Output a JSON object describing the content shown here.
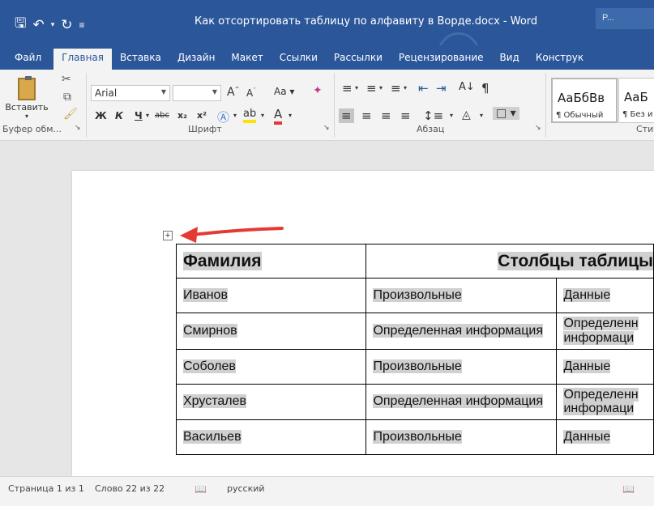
{
  "window": {
    "title": "Как отсортировать таблицу по алфавиту в Ворде.docx  -  Word",
    "account": "P..."
  },
  "qat": {
    "save_icon": "save-icon",
    "undo_icon": "undo-icon",
    "redo_icon": "redo-icon"
  },
  "tabs": [
    {
      "label": "Файл"
    },
    {
      "label": "Главная"
    },
    {
      "label": "Вставка"
    },
    {
      "label": "Дизайн"
    },
    {
      "label": "Макет"
    },
    {
      "label": "Ссылки"
    },
    {
      "label": "Рассылки"
    },
    {
      "label": "Рецензирование"
    },
    {
      "label": "Вид"
    },
    {
      "label": "Конструк"
    }
  ],
  "ribbon": {
    "clipboard": {
      "paste_label": "Вставить",
      "group_label": "Буфер обм..."
    },
    "font": {
      "font_name": "Arial",
      "font_size": "",
      "group_label": "Шрифт",
      "bold": "Ж",
      "italic": "К",
      "underline": "Ч",
      "strike": "abc",
      "subscript": "x₂",
      "superscript": "x²",
      "case": "Aa",
      "grow": "A",
      "shrink": "A"
    },
    "paragraph": {
      "group_label": "Абзац",
      "pilcrow": "¶"
    },
    "styles": {
      "group_label": "Сти",
      "items": [
        {
          "sample": "АаБбВв",
          "name": "¶ Обычный"
        },
        {
          "sample": "АаБ",
          "name": "¶ Без и"
        }
      ]
    }
  },
  "table": {
    "header": {
      "col1": "Фамилия",
      "col2": "Столбцы таблицы"
    },
    "rows": [
      {
        "name": "Иванов",
        "c2": "Произвольные",
        "c3": "Данные"
      },
      {
        "name": "Смирнов",
        "c2": "Определенная информация",
        "c3": "Определенн информаци"
      },
      {
        "name": "Соболев",
        "c2": "Произвольные",
        "c3": "Данные"
      },
      {
        "name": "Хрусталев",
        "c2": "Определенная информация",
        "c3": "Определенн информаци"
      },
      {
        "name": "Васильев",
        "c2": "Произвольные",
        "c3": "Данные"
      }
    ]
  },
  "status": {
    "page": "Страница 1 из 1",
    "words": "Слово 22 из 22",
    "language": "русский"
  },
  "colors": {
    "accent": "#2b579a",
    "arrow": "#e53a33"
  }
}
